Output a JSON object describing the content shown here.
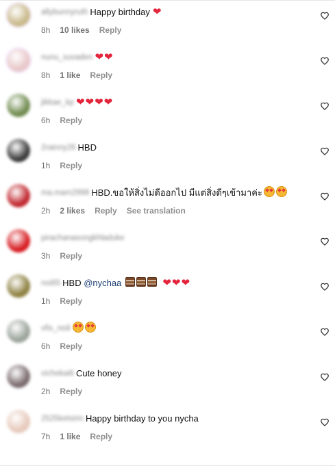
{
  "comments": [
    {
      "username": "allybunnyruth",
      "text": "Happy birthday",
      "emoji": "heart",
      "emoji_count": 1,
      "time": "8h",
      "likes": "10 likes",
      "reply": "Reply",
      "avatar_color": "#c9b98a",
      "ring": true
    },
    {
      "username": "nunu_suvaden",
      "text": "",
      "emoji": "heart",
      "emoji_count": 2,
      "time": "8h",
      "likes": "1 like",
      "reply": "Reply",
      "avatar_color": "#e8c7c8",
      "ring": true
    },
    {
      "username": "jikkae_kp",
      "text": "",
      "emoji": "heart",
      "emoji_count": 4,
      "time": "6h",
      "likes": "",
      "reply": "Reply",
      "avatar_color": "#6f8a4e",
      "ring": false
    },
    {
      "username": "2rainny26",
      "text": "HBD",
      "emoji": "",
      "emoji_count": 0,
      "time": "1h",
      "likes": "",
      "reply": "Reply",
      "avatar_color": "#3a3a3a",
      "ring": false
    },
    {
      "username": "ma.mam2998",
      "text": "HBD.ขอให้สิ่งไม่ดีออกไป มีแต่สิ่งดีๆเข้ามาค่ะ",
      "emoji": "face",
      "emoji_count": 2,
      "time": "2h",
      "likes": "2 likes",
      "reply": "Reply",
      "translation": "See translation",
      "avatar_color": "#c0262d",
      "ring": false
    },
    {
      "username": "pirachanasongkhladuke",
      "text": "",
      "emoji": "",
      "emoji_count": 0,
      "time": "3h",
      "likes": "",
      "reply": "Reply",
      "avatar_color": "#d61a1f",
      "ring": false
    },
    {
      "username": "noi65",
      "text": "HBD",
      "mention": "@nychaa",
      "emoji": "cake-heart",
      "emoji_count": 3,
      "time": "1h",
      "likes": "",
      "reply": "Reply",
      "avatar_color": "#8d8040",
      "ring": false
    },
    {
      "username": "vfis_redi",
      "text": "",
      "emoji": "face",
      "emoji_count": 2,
      "time": "6h",
      "likes": "",
      "reply": "Reply",
      "avatar_color": "#9aa39a",
      "ring": false
    },
    {
      "username": "vichekai6",
      "text": "Cute honey",
      "emoji": "",
      "emoji_count": 0,
      "time": "2h",
      "likes": "",
      "reply": "Reply",
      "avatar_color": "#7a6a6e",
      "ring": false
    },
    {
      "username": "2525ketsirin",
      "text": "Happy birthday to you nycha",
      "emoji": "",
      "emoji_count": 0,
      "time": "7h",
      "likes": "1 like",
      "reply": "Reply",
      "avatar_color": "#e6c9bb",
      "ring": false
    }
  ],
  "icons": {
    "like": "heart-outline-icon"
  },
  "colors": {
    "heart": "#e3243b",
    "mention": "#1b3d73",
    "meta": "#737373"
  }
}
